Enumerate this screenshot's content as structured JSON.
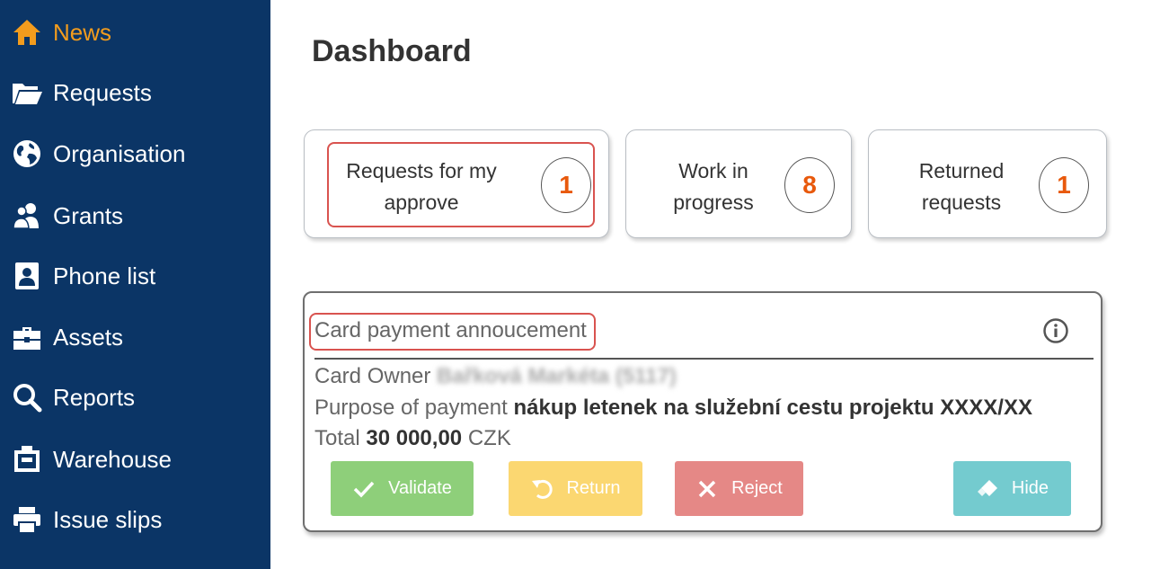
{
  "sidebar": {
    "items": [
      {
        "label": "News",
        "icon": "home-icon",
        "active": true
      },
      {
        "label": "Requests",
        "icon": "folder-open-icon"
      },
      {
        "label": "Organisation",
        "icon": "globe-icon"
      },
      {
        "label": "Grants",
        "icon": "users-icon"
      },
      {
        "label": "Phone list",
        "icon": "contact-card-icon"
      },
      {
        "label": "Assets",
        "icon": "toolbox-icon"
      },
      {
        "label": "Reports",
        "icon": "search-icon"
      },
      {
        "label": "Warehouse",
        "icon": "warehouse-icon"
      },
      {
        "label": "Issue slips",
        "icon": "printer-icon"
      }
    ],
    "bg_color": "#0b3566",
    "active_color": "#f39c1d"
  },
  "header": {
    "title": "Dashboard"
  },
  "tiles": [
    {
      "label_line1": "Requests for my",
      "label_line2": "approve",
      "count": "1",
      "highlighted": true
    },
    {
      "label_line1": "Work in",
      "label_line2": "progress",
      "count": "8"
    },
    {
      "label_line1": "Returned",
      "label_line2": "requests",
      "count": "1"
    }
  ],
  "card": {
    "title": "Card payment annoucement",
    "owner_label": "Card Owner",
    "owner_value": "Bařková Markéta (5117)",
    "purpose_label": "Purpose of payment",
    "purpose_value": "nákup letenek na služební cestu projektu XXXX/XX",
    "total_label": "Total",
    "total_value": "30 000,00",
    "total_currency": "CZK",
    "buttons": {
      "validate": "Validate",
      "return": "Return",
      "reject": "Reject",
      "hide": "Hide"
    }
  },
  "colors": {
    "count": "#e8590c",
    "highlight": "#d9534f",
    "validate": "#8ecf7a",
    "return": "#fbd771",
    "reject": "#e58886",
    "hide": "#74cbcf"
  }
}
